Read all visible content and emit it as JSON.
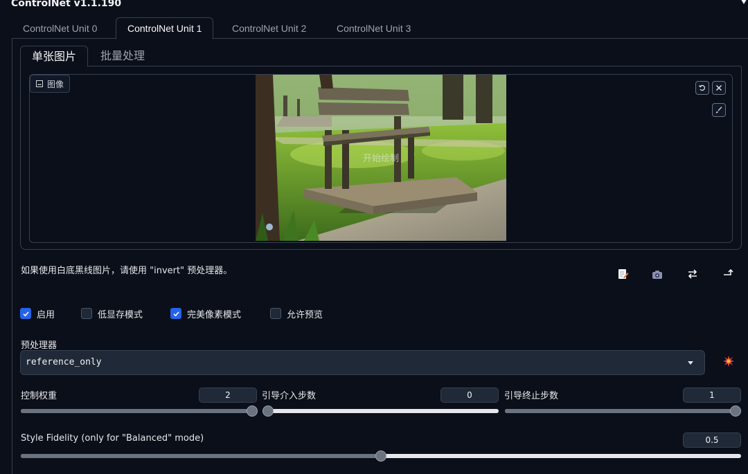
{
  "header": {
    "title": "ControlNet v1.1.190"
  },
  "unit_tabs": [
    {
      "label": "ControlNet Unit 0"
    },
    {
      "label": "ControlNet Unit 1"
    },
    {
      "label": "ControlNet Unit 2"
    },
    {
      "label": "ControlNet Unit 3"
    }
  ],
  "active_unit_tab": "ControlNet Unit 1",
  "sub_tabs": [
    {
      "label": "单张图片"
    },
    {
      "label": "批量处理"
    }
  ],
  "image_panel": {
    "label": "图像",
    "canvas_hint": "开始绘制"
  },
  "hint": "如果使用白底黑线图片，请使用 \"invert\" 预处理器。",
  "checkboxes": [
    {
      "label": "启用",
      "checked": true
    },
    {
      "label": "低显存模式",
      "checked": false
    },
    {
      "label": "完美像素模式",
      "checked": true
    },
    {
      "label": "允许预览",
      "checked": false
    }
  ],
  "preprocessor": {
    "label": "预处理器",
    "value": "reference_only"
  },
  "sliders": {
    "weight": {
      "label": "控制权重",
      "value": "2",
      "fraction": 1.0
    },
    "start": {
      "label": "引导介入步数",
      "value": "0",
      "fraction": 0.0
    },
    "end": {
      "label": "引导终止步数",
      "value": "1",
      "fraction": 1.0
    },
    "fidelity": {
      "label": "Style Fidelity (only for \"Balanced\" mode)",
      "value": "0.5",
      "fraction": 0.5
    }
  },
  "colors": {
    "background": "#0b0f19",
    "accent": "#2563eb",
    "border": "#374151"
  }
}
